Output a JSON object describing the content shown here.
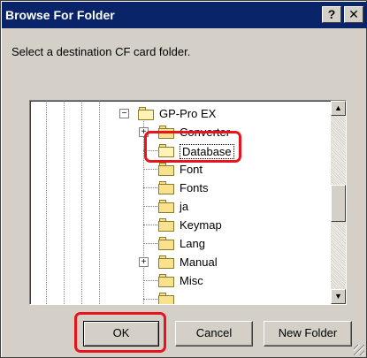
{
  "window": {
    "title": "Browse For Folder",
    "help_glyph": "?",
    "close_glyph": "✕"
  },
  "instruction": "Select a destination CF card folder.",
  "tree": {
    "root": {
      "label": "GP-Pro EX",
      "expander": "⊟",
      "icon": "open-folder-icon"
    },
    "items": [
      {
        "label": "Converter",
        "expander": "+",
        "icon": "folder-icon"
      },
      {
        "label": "Database",
        "expander": "",
        "icon": "open-folder-icon",
        "selected": true
      },
      {
        "label": "Font",
        "expander": "",
        "icon": "folder-icon"
      },
      {
        "label": "Fonts",
        "expander": "",
        "icon": "folder-icon"
      },
      {
        "label": "ja",
        "expander": "",
        "icon": "folder-icon"
      },
      {
        "label": "Keymap",
        "expander": "",
        "icon": "folder-icon"
      },
      {
        "label": "Lang",
        "expander": "",
        "icon": "folder-icon"
      },
      {
        "label": "Manual",
        "expander": "+",
        "icon": "folder-icon"
      },
      {
        "label": "Misc",
        "expander": "",
        "icon": "folder-icon"
      }
    ]
  },
  "scrollbar": {
    "up_glyph": "▲",
    "down_glyph": "▼"
  },
  "buttons": {
    "ok": "OK",
    "cancel": "Cancel",
    "new_folder": "New Folder"
  },
  "highlight_color": "#e8141c",
  "title_color": "#0a246a"
}
